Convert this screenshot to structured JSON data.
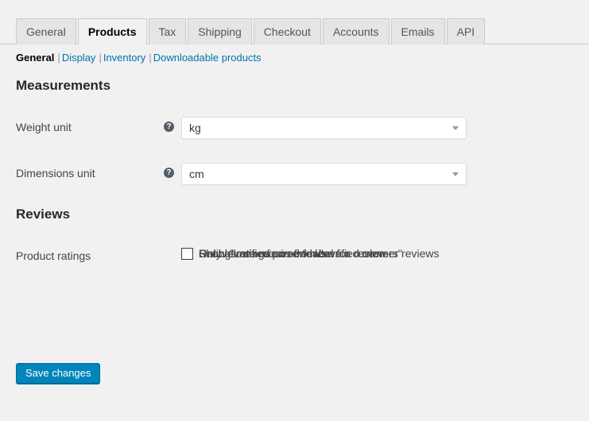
{
  "colors": {
    "page_background": "#f1f1f1",
    "tab_inactive_background": "#e5e5e5",
    "tab_border": "#cccccc",
    "link_blue": "#0073aa",
    "button_blue": "#0085ba",
    "button_border": "#006799",
    "heading_text": "#23282d",
    "body_text": "#444444",
    "help_icon": "#555d66",
    "select_border": "#dddddd"
  },
  "tabs": [
    {
      "label": "General",
      "active": false
    },
    {
      "label": "Products",
      "active": true
    },
    {
      "label": "Tax",
      "active": false
    },
    {
      "label": "Shipping",
      "active": false
    },
    {
      "label": "Checkout",
      "active": false
    },
    {
      "label": "Accounts",
      "active": false
    },
    {
      "label": "Emails",
      "active": false
    },
    {
      "label": "API",
      "active": false
    }
  ],
  "subnav": {
    "separator": "|",
    "items": [
      {
        "label": "General",
        "current": true
      },
      {
        "label": "Display",
        "current": false
      },
      {
        "label": "Inventory",
        "current": false
      },
      {
        "label": "Downloadable products",
        "current": false
      }
    ]
  },
  "sections": {
    "measurements": {
      "heading": "Measurements",
      "weight_unit": {
        "label": "Weight unit",
        "help_icon": "help-question-icon",
        "help_glyph": "?",
        "value": "kg"
      },
      "dimensions_unit": {
        "label": "Dimensions unit",
        "help_icon": "help-question-icon",
        "help_glyph": "?",
        "value": "cm"
      }
    },
    "reviews": {
      "heading": "Reviews",
      "product_ratings": {
        "label": "Product ratings",
        "options": [
          {
            "label": "Enable ratings on reviews",
            "checked": true
          },
          {
            "label": "Ratings are required to leave a review",
            "checked": true
          },
          {
            "label": "Show \"verified owner\" label for customer reviews",
            "checked": true
          },
          {
            "label": "Only allow reviews from \"verified owners\"",
            "checked": false
          }
        ]
      }
    }
  },
  "actions": {
    "save_label": "Save changes"
  }
}
